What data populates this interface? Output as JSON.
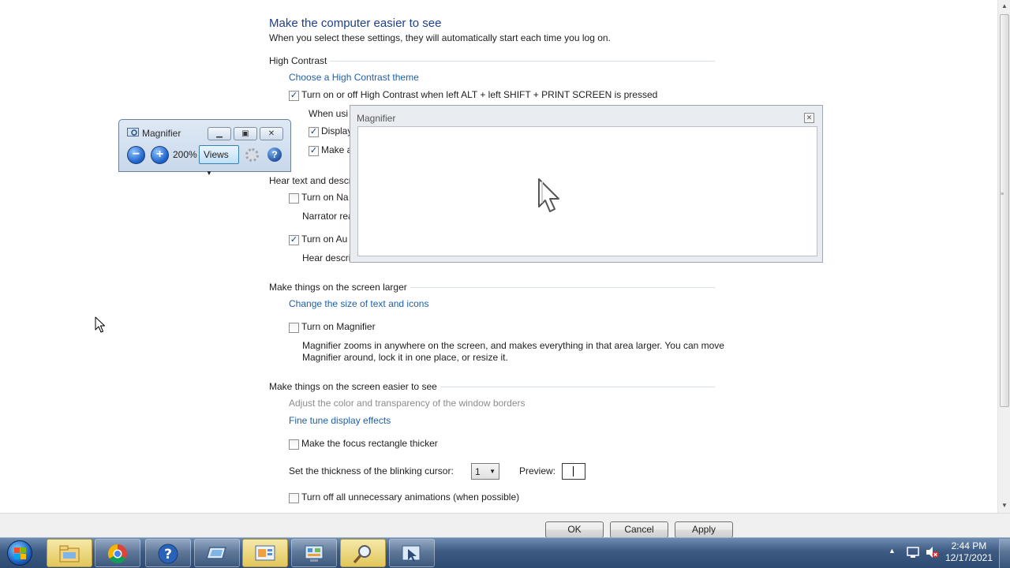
{
  "header": {
    "title": "Make the computer easier to see",
    "subtitle": "When you select these settings, they will automatically start each time you log on."
  },
  "high_contrast": {
    "heading": "High Contrast",
    "link": "Choose a High Contrast theme",
    "toggle_label": "Turn on or off High Contrast when left ALT + left SHIFT + PRINT SCREEN is pressed",
    "when_using_label": "When usi",
    "display_label": "Display",
    "make_label": "Make a"
  },
  "hear_text": {
    "heading": "Hear text and descr",
    "narrator_label": "Turn on Na",
    "narrator_desc": "Narrator rea",
    "audio_label": "Turn on Au",
    "audio_desc": "Hear descri"
  },
  "larger": {
    "heading": "Make things on the screen larger",
    "link": "Change the size of text and icons",
    "magnifier_label": "Turn on Magnifier",
    "magnifier_desc_1": "Magnifier zooms in anywhere on the screen, and makes everything in that area larger. You can move",
    "magnifier_desc_2": "Magnifier around, lock it in one place, or resize it."
  },
  "easier": {
    "heading": "Make things on the screen easier to see",
    "adjust_link": "Adjust the color and transparency of the window borders",
    "fine_tune_link": "Fine tune display effects",
    "focus_label": "Make the focus rectangle thicker",
    "cursor_label": "Set the thickness of the blinking cursor:",
    "cursor_value": "1",
    "preview_label": "Preview:",
    "animations_label": "Turn off all unnecessary animations (when possible)"
  },
  "checkboxes": {
    "high_contrast_toggle": true,
    "display": true,
    "make": true,
    "narrator": false,
    "audio": true,
    "magnifier": false,
    "focus": false,
    "animations": false
  },
  "buttons": {
    "ok": "OK",
    "cancel": "Cancel",
    "apply": "Apply"
  },
  "magnifier_toolbar": {
    "title": "Magnifier",
    "zoom": "200%",
    "views": "Views",
    "minus": "−",
    "plus": "+",
    "help": "?"
  },
  "magnifier_lens": {
    "title": "Magnifier"
  },
  "taskbar": {
    "apps": [
      "file-explorer",
      "chrome",
      "help",
      "control-panel-laptop",
      "presentation",
      "control-panel",
      "magnifier",
      "ease-of-access"
    ],
    "time": "2:44 PM",
    "date": "12/17/2021"
  },
  "colors": {
    "link": "#1f5fa8",
    "title": "#1e3f8a",
    "taskbar": "#3c5a82"
  }
}
